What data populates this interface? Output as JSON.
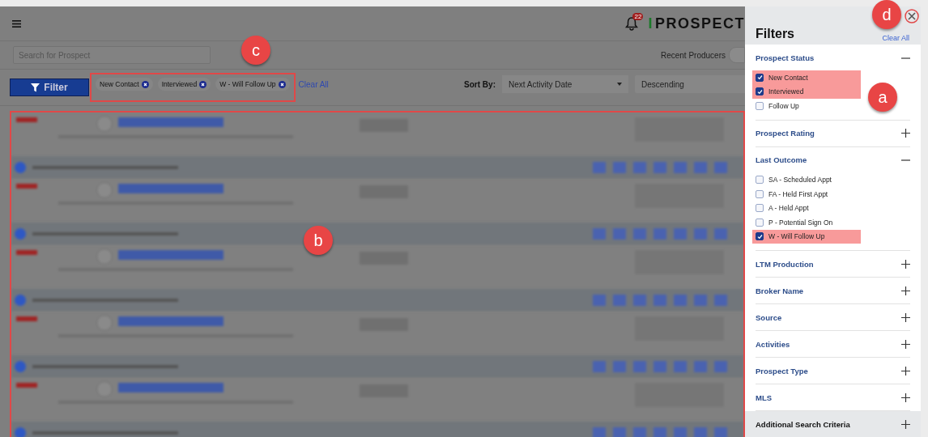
{
  "header": {
    "notification_count": "22",
    "logo_mark": "I",
    "logo": "PROSPECT"
  },
  "search": {
    "placeholder": "Search for Prospect"
  },
  "recent_producers": {
    "label": "Recent Producers",
    "on": false
  },
  "filter_button": "Filter",
  "active_filters": [
    {
      "label": "New Contact"
    },
    {
      "label": "Interviewed"
    },
    {
      "label": "W - Will Follow Up"
    }
  ],
  "clear_all": "Clear All",
  "sort": {
    "label": "Sort By:",
    "field": "Next Activity Date",
    "order": "Descending"
  },
  "filters_panel": {
    "title": "Filters",
    "clear_all": "Clear All",
    "sections": [
      {
        "title": "Prospect Status",
        "expanded": true,
        "options": [
          {
            "label": "New Contact",
            "checked": true,
            "highlighted": true
          },
          {
            "label": "Interviewed",
            "checked": true,
            "highlighted": true
          },
          {
            "label": "Follow Up",
            "checked": false,
            "highlighted": false
          }
        ]
      },
      {
        "title": "Prospect Rating",
        "expanded": false
      },
      {
        "title": "Last Outcome",
        "expanded": true,
        "options": [
          {
            "label": "SA - Scheduled Appt",
            "checked": false,
            "highlighted": false
          },
          {
            "label": "FA - Held First Appt",
            "checked": false,
            "highlighted": false
          },
          {
            "label": "A - Held Appt",
            "checked": false,
            "highlighted": false
          },
          {
            "label": "P - Potential Sign On",
            "checked": false,
            "highlighted": false
          },
          {
            "label": "W - Will Follow Up",
            "checked": true,
            "highlighted": true
          }
        ]
      },
      {
        "title": "LTM Production",
        "expanded": false
      },
      {
        "title": "Broker Name",
        "expanded": false
      },
      {
        "title": "Source",
        "expanded": false
      },
      {
        "title": "Activities",
        "expanded": false
      },
      {
        "title": "Prospect Type",
        "expanded": false
      },
      {
        "title": "MLS",
        "expanded": false
      }
    ],
    "footer": {
      "title": "Additional Search Criteria",
      "expanded": false
    }
  },
  "callouts": {
    "filters": "c",
    "list": "b",
    "panel": "a",
    "close": "d"
  }
}
